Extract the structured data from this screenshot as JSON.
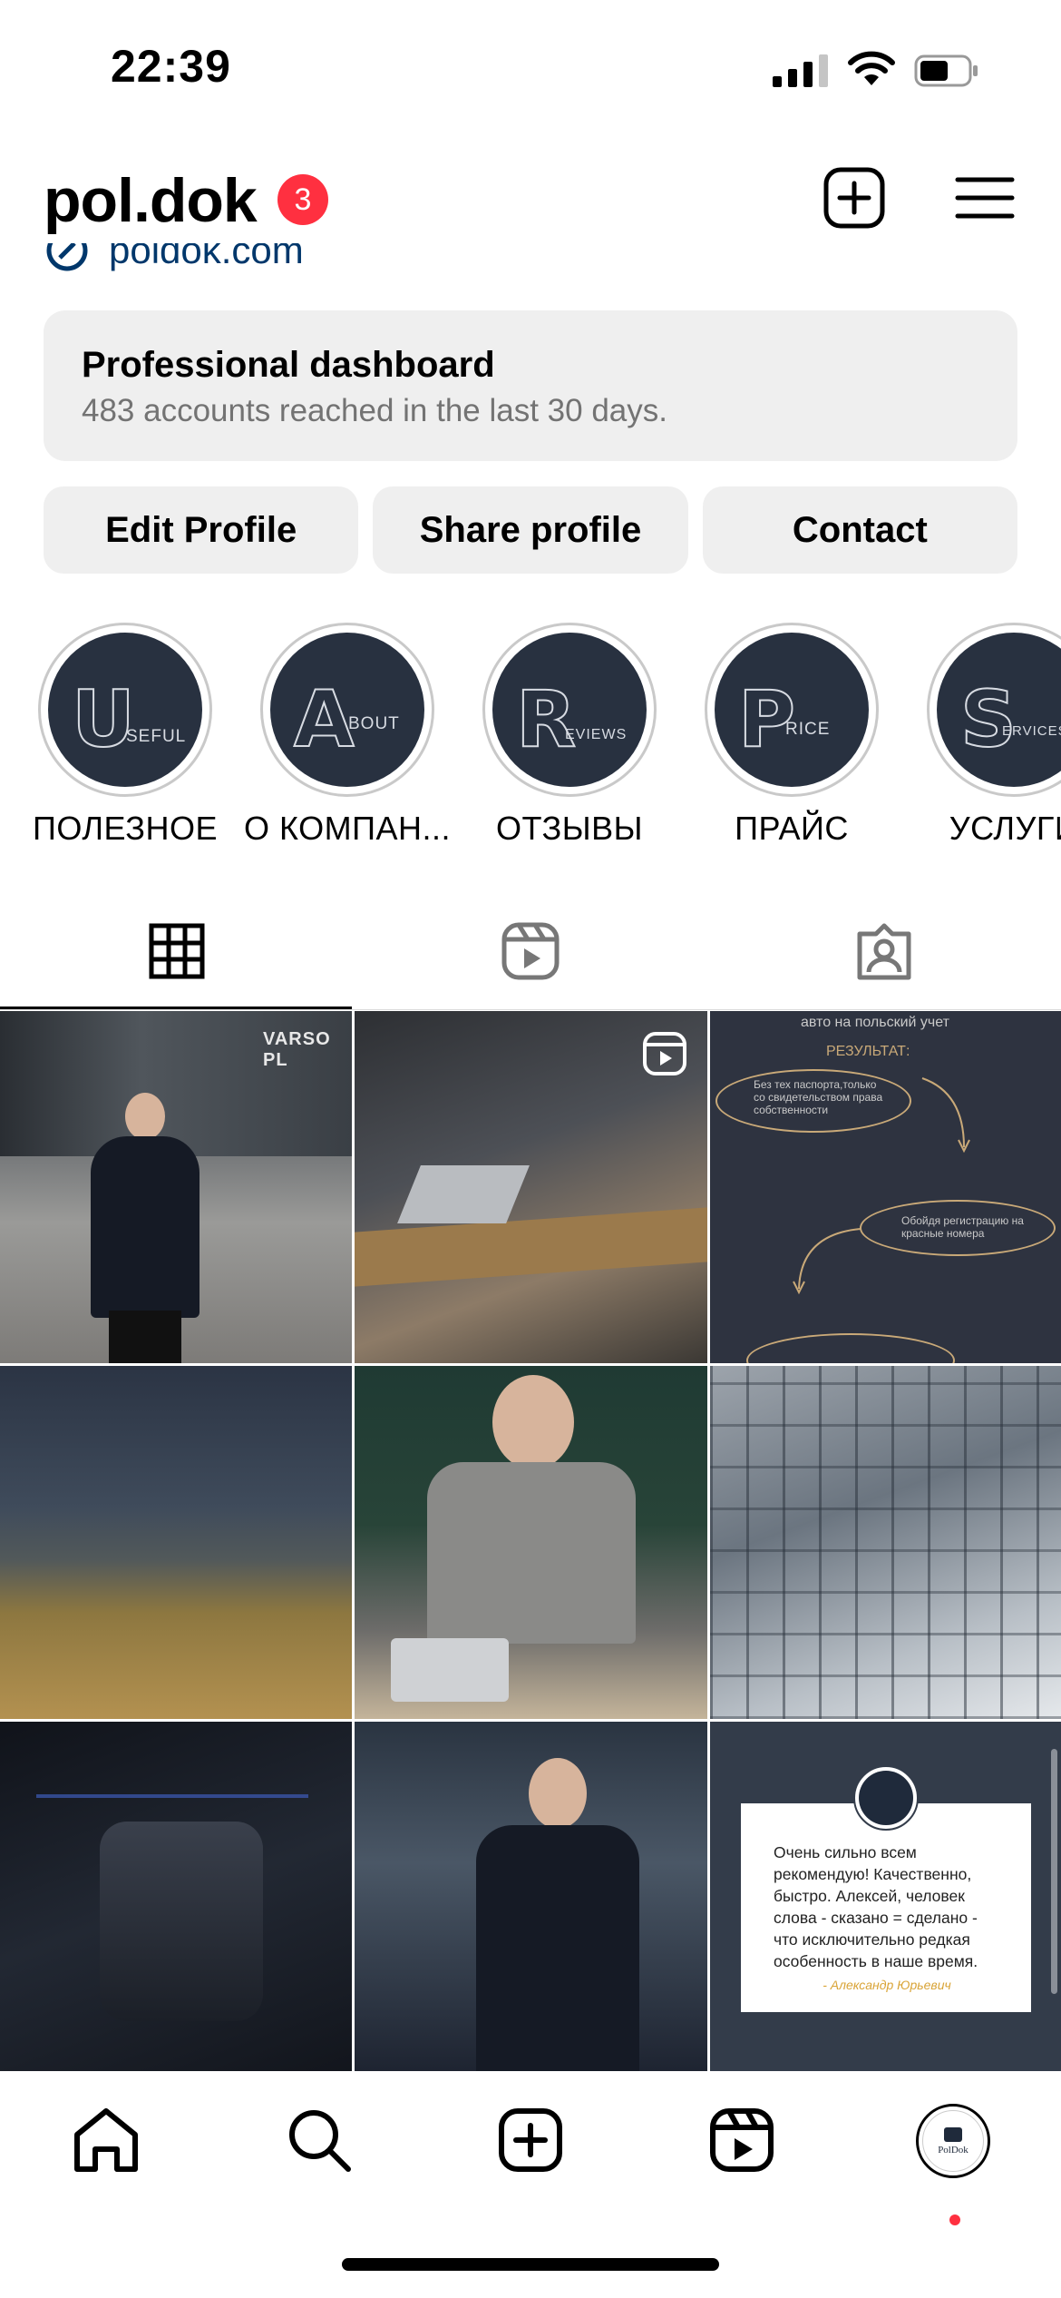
{
  "status_bar": {
    "time": "22:39"
  },
  "header": {
    "username": "pol.dok",
    "notification_count": "3"
  },
  "link": {
    "text": "poldok.com"
  },
  "dashboard": {
    "title": "Professional dashboard",
    "subtitle": "483 accounts reached in the last 30 days."
  },
  "actions": {
    "edit": "Edit Profile",
    "share": "Share profile",
    "contact": "Contact"
  },
  "highlights": [
    {
      "letter": "U",
      "rest": "SEFUL",
      "label": "ПОЛЕЗНОЕ"
    },
    {
      "letter": "A",
      "rest": "BOUT",
      "label": "О КОМПАН..."
    },
    {
      "letter": "R",
      "rest": "EVIEWS",
      "label": "ОТЗЫВЫ"
    },
    {
      "letter": "P",
      "rest": "RICE",
      "label": "ПРАЙС"
    },
    {
      "letter": "S",
      "rest": "ERVICES",
      "label": "УСЛУГИ"
    }
  ],
  "tabs": [
    "grid-icon",
    "reels-icon",
    "tagged-icon"
  ],
  "posts": {
    "tile1_sign": "VARSO PL",
    "tile3": {
      "line1": "авто на польский учет",
      "line2": "РЕЗУЛЬТАТ:",
      "oval1": "Без тех паспорта,только со свидетельством права собственности",
      "oval2": "Обойдя регистрацию на красные номера"
    },
    "review": {
      "logo": "PolDok",
      "text": "Очень сильно всем рекомендую! Качественно, быстро. Алексей, человек слова - сказано = сделано - что исключительно редкая особенность в наше время.",
      "author": "- Александр Юрьевич"
    }
  },
  "colors": {
    "badge": "#ff3040",
    "link": "#00376b",
    "button_bg": "#efefef",
    "highlight_disc": "#283140"
  },
  "bottom_nav": [
    "home-icon",
    "search-icon",
    "create-icon",
    "reels-icon",
    "profile-avatar"
  ]
}
